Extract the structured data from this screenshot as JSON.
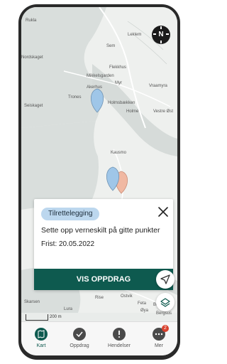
{
  "map": {
    "labels": [
      "Rukla",
      "Leklem",
      "Sem",
      "Flekkhus",
      "Nordskaget",
      "Mikkelsgarden",
      "Akerhus",
      "Myr",
      "Vraamyra",
      "Trones",
      "Seiskaget",
      "Holmsbækken",
      "Holme",
      "Vestre Øst",
      "Kausmo",
      "Ostvik",
      "Feta",
      "Rise",
      "Øya",
      "Skarsen",
      "Berg",
      "Lura",
      "Bergsus"
    ],
    "compass_label": "N",
    "scale_label": "200 m",
    "colors": {
      "water": "#d9dedc",
      "land": "#eef0ee",
      "pin_blue": "#9fc6e8",
      "pin_peach": "#f0b8a2"
    }
  },
  "card": {
    "badge": "Tilrettelegging",
    "title": "Sette opp verneskilt på gitte punkter",
    "deadline": "Frist: 20.05.2022",
    "action": "VIS OPPDRAG",
    "accent": "#0e5a4f"
  },
  "fabs": {
    "locate_icon": "navigation-arrow-icon",
    "layers_icon": "layers-icon"
  },
  "nav": {
    "items": [
      {
        "label": "Kart",
        "icon": "map-icon"
      },
      {
        "label": "Oppdrag",
        "icon": "check-circle-icon"
      },
      {
        "label": "Hendelser",
        "icon": "exclamation-icon"
      },
      {
        "label": "Mer",
        "icon": "more-icon"
      }
    ],
    "notification_count": "2"
  }
}
